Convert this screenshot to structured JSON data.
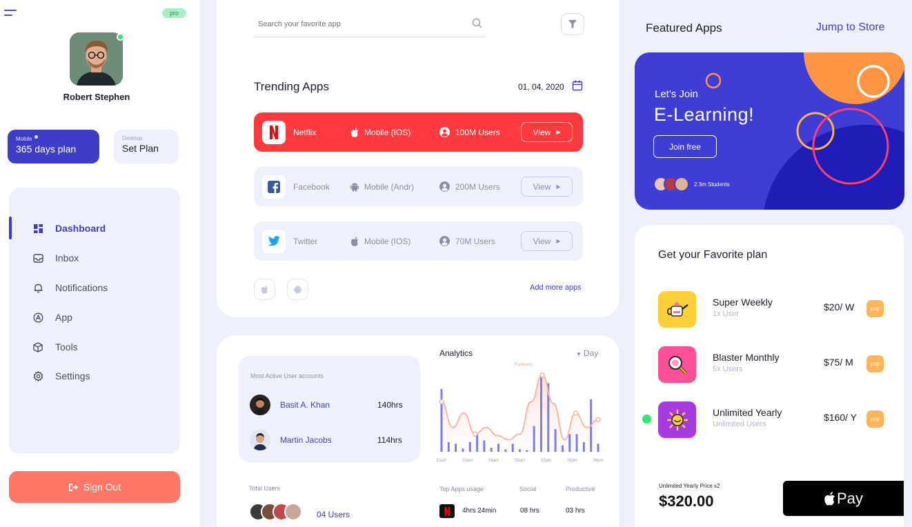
{
  "sidebar": {
    "pro_badge": "pro",
    "user_name": "Robert Stephen",
    "plans": [
      {
        "small": "Mobile",
        "big": "365 days plan"
      },
      {
        "small": "Desktop",
        "big": "Set Plan"
      }
    ],
    "nav": [
      {
        "label": "Dashboard",
        "icon": "dashboard-icon",
        "active": true
      },
      {
        "label": "Inbox",
        "icon": "inbox-icon"
      },
      {
        "label": "Notifications",
        "icon": "bell-icon"
      },
      {
        "label": "App",
        "icon": "app-icon"
      },
      {
        "label": "Tools",
        "icon": "cube-icon"
      },
      {
        "label": "Settings",
        "icon": "gear-icon"
      }
    ],
    "sign_out": "Sign Out"
  },
  "search": {
    "placeholder": "Search your favorite app"
  },
  "trending": {
    "title": "Trending Apps",
    "date": "01, 04, 2020",
    "apps": [
      {
        "name": "Netflix",
        "platform": "Mobile (IOS)",
        "users": "100M Users",
        "view": "View"
      },
      {
        "name": "Facebook",
        "platform": "Mobile (Andr)",
        "users": "200M Users",
        "view": "View"
      },
      {
        "name": "Twitter",
        "platform": "Mobile (IOS)",
        "users": "70M Users",
        "view": "View"
      }
    ],
    "add_more": "Add more apps"
  },
  "active_users": {
    "title": "Most Active User accounts",
    "people": [
      {
        "name": "Basit A. Khan",
        "hours": "140hrs"
      },
      {
        "name": "Martin Jacobs",
        "hours": "114hrs"
      }
    ],
    "total_label": "Total Users",
    "total_value": "04 Users"
  },
  "analytics": {
    "title": "Analytics",
    "range": "Day",
    "peak_label": "Ranbeury"
  },
  "chart_data": {
    "type": "bar",
    "title": "Analytics",
    "categories": [
      "12am",
      "03am",
      "06am",
      "09am",
      "12pm",
      "03pm",
      "06pm"
    ],
    "line": [
      62,
      30,
      48,
      22,
      30,
      20,
      15,
      22,
      62,
      95,
      60,
      15,
      48,
      30,
      40
    ],
    "bars": [
      78,
      12,
      10,
      4,
      12,
      22,
      14,
      5,
      10,
      3,
      10,
      3,
      2,
      32,
      95,
      85,
      28,
      8,
      22,
      22,
      12,
      65,
      10
    ],
    "ylim": [
      0,
      100
    ]
  },
  "usage": {
    "headers": [
      "Top Apps usage",
      "Social",
      "Productive"
    ],
    "values": [
      "4hrs 24min",
      "08 hrs",
      "03 hrs"
    ]
  },
  "featured": {
    "title": "Featured Apps",
    "jump": "Jump to Store",
    "promo_small": "Let's Join",
    "promo_big": "E-Learning!",
    "join": "Join free",
    "students": "2.3m Students"
  },
  "plans": {
    "title": "Get your Favorite plan",
    "items": [
      {
        "name": "Super Weekly",
        "users": "1x User",
        "price": "$20/ W",
        "pay": "pay"
      },
      {
        "name": "Blaster Monthly",
        "users": "5x Users",
        "price": "$75/ M",
        "pay": "pay"
      },
      {
        "name": "Unlimited Yearly",
        "users": "Unlimited Users",
        "price": "$160/ Y",
        "pay": "pay"
      }
    ],
    "price_label": "Unlimited Yearly Price x2",
    "price_total": "$320.00",
    "apple_pay": "Pay"
  },
  "colors": {
    "accent": "#3f3dc8",
    "netflix": "#ff3b3f",
    "signout": "#ff7765",
    "online": "#2ee872"
  }
}
